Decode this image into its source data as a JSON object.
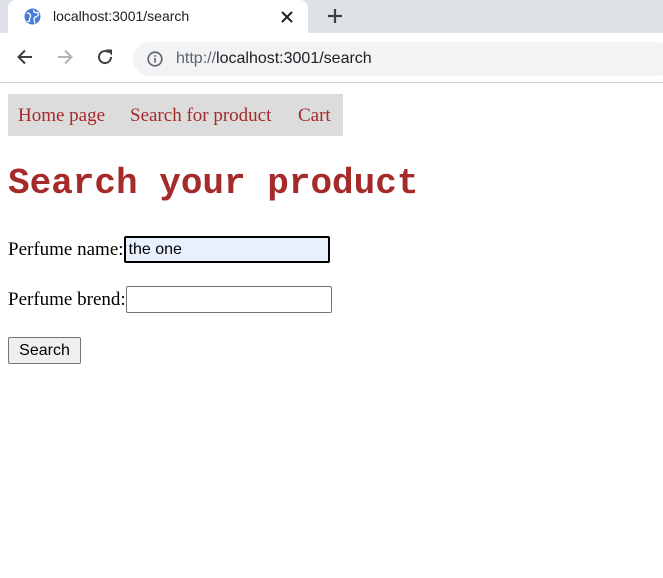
{
  "browser": {
    "tab_title": "localhost:3001/search",
    "url_scheme": "http://",
    "url_rest": "localhost:3001/search"
  },
  "icons": {
    "favicon": "globe-icon",
    "tab_close": "close-icon",
    "new_tab": "plus-icon",
    "back": "back-arrow-icon",
    "forward": "forward-arrow-icon",
    "reload": "reload-icon",
    "site_info": "info-icon"
  },
  "site_nav": {
    "items": [
      {
        "label": "Home page"
      },
      {
        "label": "Search for product"
      },
      {
        "label": "Cart"
      }
    ]
  },
  "main": {
    "title": "Search your product",
    "fields": [
      {
        "label": "Perfume name:",
        "value": "the one",
        "placeholder": ""
      },
      {
        "label": "Perfume brend:",
        "value": "",
        "placeholder": ""
      }
    ],
    "search_label": "Search"
  },
  "colors": {
    "accent": "#a52a2a",
    "nav_background": "#dcdcdc",
    "autofill_background": "#e8f0fe"
  }
}
